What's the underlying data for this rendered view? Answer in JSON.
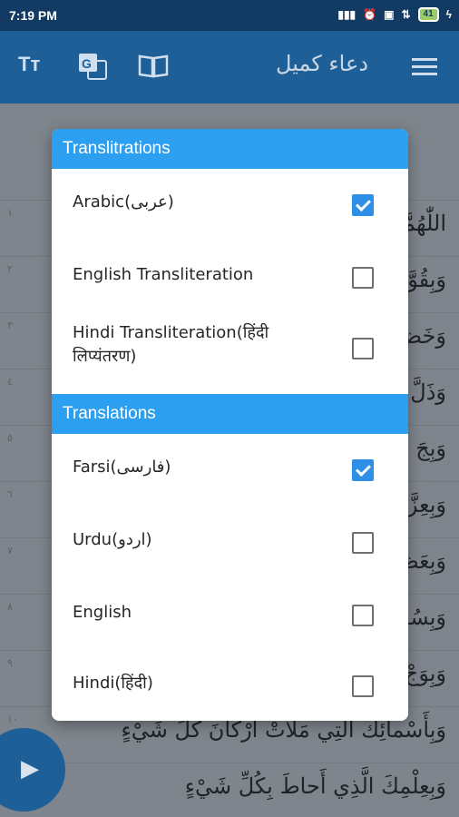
{
  "status_bar": {
    "time": "7:19 PM",
    "battery": "41",
    "icons": [
      "signal-icon",
      "alarm-icon",
      "sim-icon",
      "network-4g-icon",
      "battery-icon",
      "charging-icon"
    ]
  },
  "app_bar": {
    "title": "دعاء كميل",
    "icons": [
      "text-size-icon",
      "translate-icon",
      "book-icon",
      "menu-icon"
    ]
  },
  "background_verses": [
    {
      "num": "١",
      "text": "اللّٰهُمَّ"
    },
    {
      "num": "٢",
      "text": "وَبِقُوَّ"
    },
    {
      "num": "٣",
      "text": "وَخَضَ"
    },
    {
      "num": "٤",
      "text": "وَذَلَّ"
    },
    {
      "num": "٥",
      "text": "وَبِجَ"
    },
    {
      "num": "٦",
      "text": "وَبِعِزَّ"
    },
    {
      "num": "٧",
      "text": "وَبِعَظَ"
    },
    {
      "num": "٨",
      "text": "وَبِسُلْ"
    },
    {
      "num": "٩",
      "text": "وَبِوَجْ"
    },
    {
      "num": "١٠",
      "text": "وَبِأَسْمائِكَ الَّتِي مَلأَتْ أَرْكانَ كُلِّ شَيْءٍ"
    },
    {
      "num": "١١",
      "text": "وَبِعِلْمِكَ الَّذِي أَحاطَ بِكُلِّ شَيْءٍ"
    }
  ],
  "dialog": {
    "sections": [
      {
        "title": "Translitrations",
        "options": [
          {
            "label": "Arabic(عربی)",
            "checked": true
          },
          {
            "label": "English Transliteration",
            "checked": false
          },
          {
            "label": "Hindi Transliteration(हिंदी लिप्यंतरण)",
            "checked": false
          }
        ]
      },
      {
        "title": "Translations",
        "options": [
          {
            "label": "Farsi(فارسی)",
            "checked": true
          },
          {
            "label": "Urdu(اردو)",
            "checked": false
          },
          {
            "label": "English",
            "checked": false
          },
          {
            "label": "Hindi(हिंदी)",
            "checked": false
          }
        ]
      }
    ]
  },
  "player": {
    "play_icon": "play-icon"
  },
  "colors": {
    "primary": "#1e5f97",
    "status_bar": "#123a63",
    "section_header": "#2d9ff0",
    "checkbox_checked": "#2d8fe6"
  }
}
